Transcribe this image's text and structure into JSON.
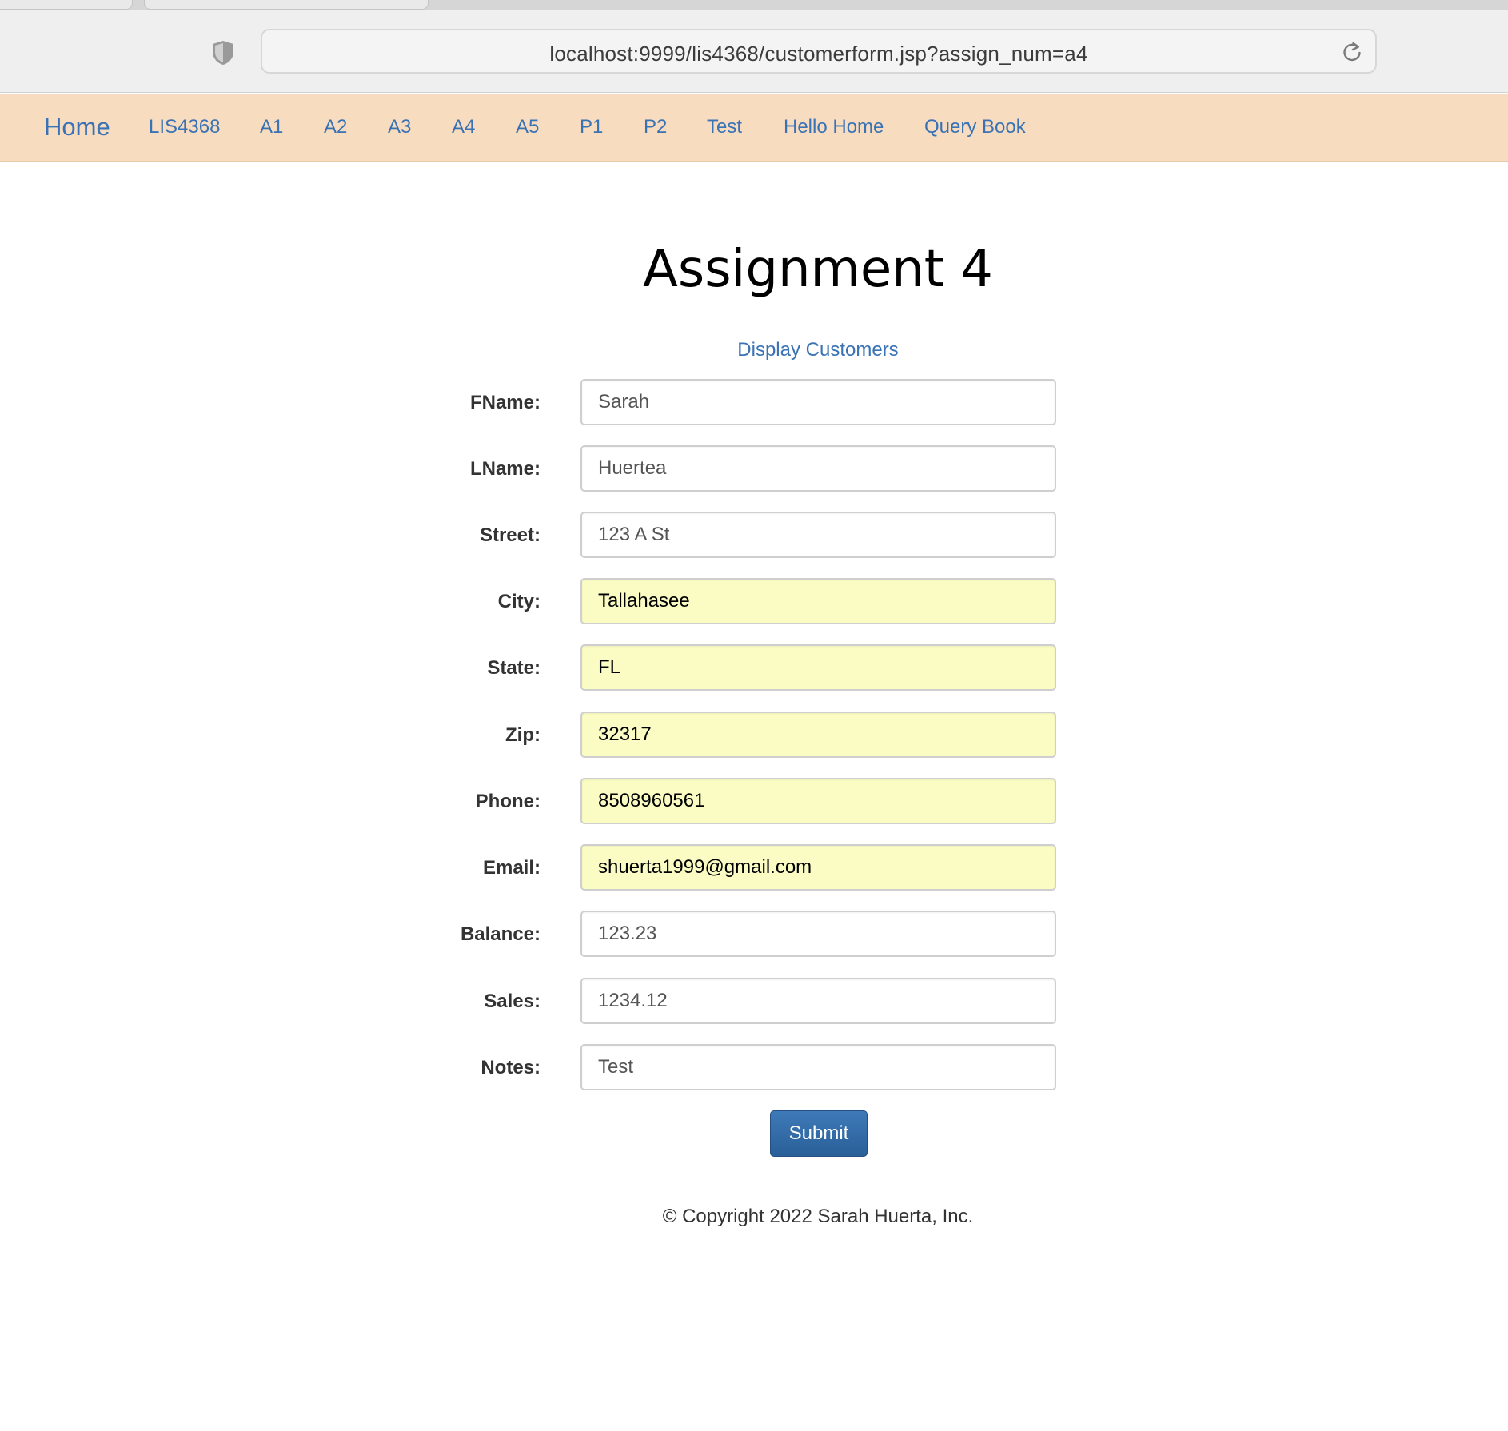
{
  "browser": {
    "url": "localhost:9999/lis4368/customerform.jsp?assign_num=a4"
  },
  "nav": {
    "brand": "Home",
    "items": [
      "LIS4368",
      "A1",
      "A2",
      "A3",
      "A4",
      "A5",
      "P1",
      "P2",
      "Test",
      "Hello Home",
      "Query Book"
    ],
    "link_color": "#3a73b5",
    "background": "#f8dcbf"
  },
  "main": {
    "title": "Assignment 4",
    "display_link": "Display Customers"
  },
  "form": {
    "fields": [
      {
        "label": "FName:",
        "value": "Sarah",
        "autofilled": false
      },
      {
        "label": "LName:",
        "value": "Huertea",
        "autofilled": false
      },
      {
        "label": "Street:",
        "value": "123 A St",
        "autofilled": false
      },
      {
        "label": "City:",
        "value": "Tallahasee",
        "autofilled": true
      },
      {
        "label": "State:",
        "value": "FL",
        "autofilled": true
      },
      {
        "label": "Zip:",
        "value": "32317",
        "autofilled": true
      },
      {
        "label": "Phone:",
        "value": "8508960561",
        "autofilled": true
      },
      {
        "label": "Email:",
        "value": "shuerta1999@gmail.com",
        "autofilled": true
      },
      {
        "label": "Balance:",
        "value": "123.23",
        "autofilled": false
      },
      {
        "label": "Sales:",
        "value": "1234.12",
        "autofilled": false
      },
      {
        "label": "Notes:",
        "value": "Test",
        "autofilled": false
      }
    ],
    "submit_label": "Submit",
    "autofill_color": "#fafcc4",
    "button_color": "#2f6aa8"
  },
  "footer": {
    "text": "© Copyright 2022 Sarah Huerta, Inc."
  },
  "icons": {
    "shield": "shield-icon",
    "reload": "reload-icon"
  }
}
